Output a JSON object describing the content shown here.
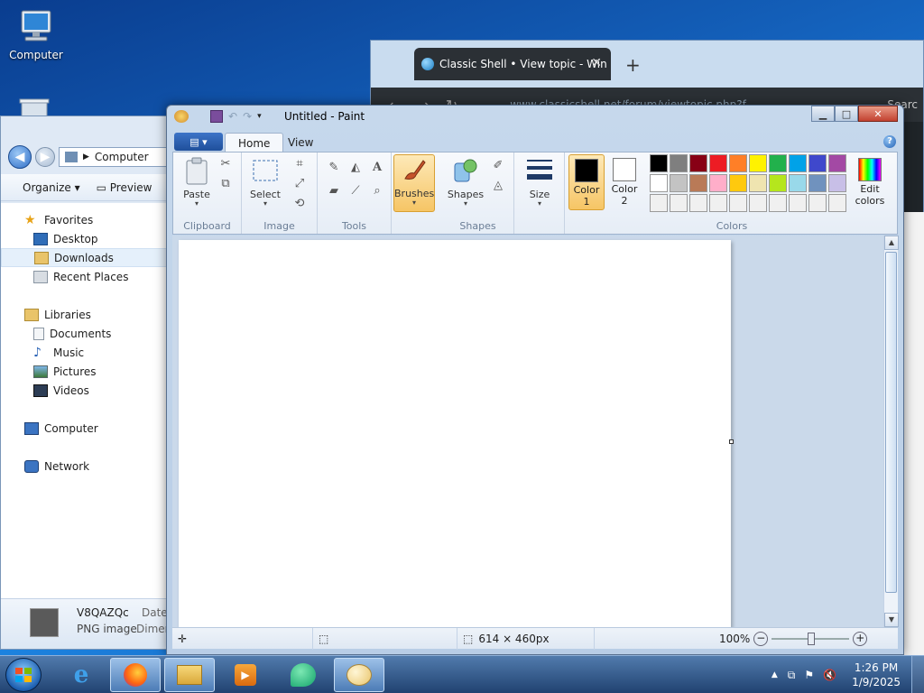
{
  "desktop": {
    "icons": [
      {
        "label": "Computer"
      }
    ]
  },
  "browser": {
    "tab_title": "Classic Shell • View topic - Win",
    "url": "www.classicshell.net/forum/viewtopic.php?f",
    "right_text": "Searc"
  },
  "explorer": {
    "address": "Computer",
    "toolbar": {
      "organize": "Organize",
      "preview": "Preview"
    },
    "nav": {
      "favorites": "Favorites",
      "desktop": "Desktop",
      "downloads": "Downloads",
      "recent": "Recent Places",
      "libraries": "Libraries",
      "documents": "Documents",
      "music": "Music",
      "pictures": "Pictures",
      "videos": "Videos",
      "computer": "Computer",
      "network": "Network"
    },
    "details": {
      "name": "V8QAZQc",
      "type": "PNG image",
      "date_label": "Date",
      "dim_label": "Dimen"
    }
  },
  "paint": {
    "title": "Untitled - Paint",
    "tabs": {
      "home": "Home",
      "view": "View"
    },
    "groups": {
      "clipboard": "Clipboard",
      "image": "Image",
      "tools": "Tools",
      "shapes": "Shapes",
      "colors": "Colors"
    },
    "buttons": {
      "paste": "Paste",
      "select": "Select",
      "brushes": "Brushes",
      "shapes": "Shapes",
      "size": "Size",
      "color1": "Color",
      "color1_n": "1",
      "color2": "Color",
      "color2_n": "2",
      "edit_colors_1": "Edit",
      "edit_colors_2": "colors"
    },
    "color1_value": "#000000",
    "color2_value": "#ffffff",
    "palette": [
      "#000000",
      "#7f7f7f",
      "#880015",
      "#ed1c24",
      "#ff7f27",
      "#fff200",
      "#22b14c",
      "#00a2e8",
      "#3f48cc",
      "#a349a4",
      "#ffffff",
      "#c3c3c3",
      "#b97a57",
      "#ffaec9",
      "#ffc90e",
      "#efe4b0",
      "#b5e61d",
      "#99d9ea",
      "#7092be",
      "#c8bfe7",
      "#f0f0f0",
      "#f0f0f0",
      "#f0f0f0",
      "#f0f0f0",
      "#f0f0f0",
      "#f0f0f0",
      "#f0f0f0",
      "#f0f0f0",
      "#f0f0f0",
      "#f0f0f0"
    ],
    "status": {
      "dimensions": "614 × 460px",
      "zoom": "100%"
    }
  },
  "taskbar": {
    "time": "1:26 PM",
    "date": "1/9/2025"
  }
}
